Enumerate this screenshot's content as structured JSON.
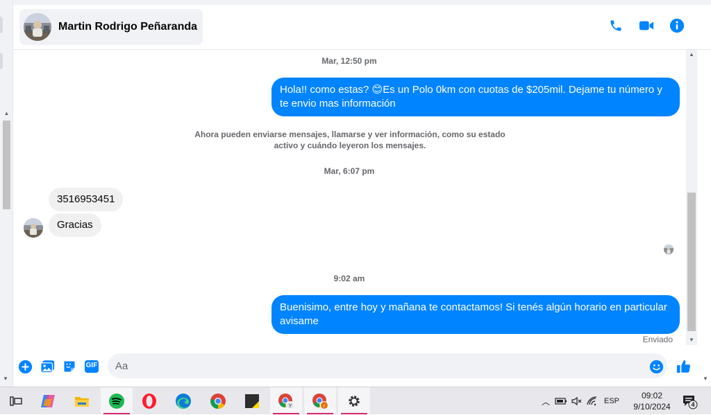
{
  "header": {
    "contact_name": "Martin Rodrigo Peñaranda",
    "icons": [
      "phone-icon",
      "video-camera-icon",
      "info-icon"
    ],
    "accent_color": "#0084ff"
  },
  "chat": {
    "timestamp_1": "Mar, 12:50 pm",
    "outgoing_1": "Hola!! como estas? 😊Es un Polo 0km con cuotas de $205mil. Dejame tu número y te envio mas información",
    "system_note_line1": "Ahora pueden enviarse mensajes, llamarse y ver información, como su estado",
    "system_note_line2": "activo y cuándo leyeron los mensajes.",
    "timestamp_2": "Mar, 6:07 pm",
    "incoming_1": "3516953451",
    "incoming_2": "Gracias",
    "timestamp_3": "9:02 am",
    "outgoing_2": "Buenisimo, entre hoy y mañana te contactamos! Si tenés algún horario en particular avisame",
    "status": "Enviado"
  },
  "composer": {
    "placeholder": "Aa",
    "icons": [
      "plus-icon",
      "photo-icon",
      "sticker-icon",
      "gif-icon",
      "emoji-icon",
      "like-icon"
    ],
    "gif_label": "GIF"
  },
  "taskbar": {
    "apps": [
      "task-view",
      "copilot",
      "file-explorer",
      "spotify",
      "opera",
      "edge",
      "chrome",
      "sticky-notes",
      "chrome-profile-y",
      "chrome-profile-r",
      "settings"
    ],
    "language": "ESP",
    "time": "09:02",
    "date": "9/10/2024",
    "notification_count": "4"
  }
}
